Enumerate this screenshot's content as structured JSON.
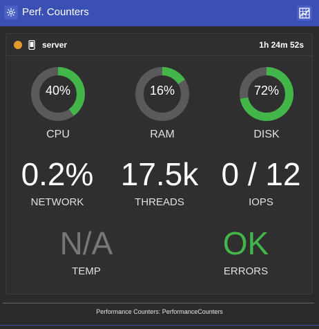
{
  "window": {
    "title": "Perf. Counters",
    "left_icon": "gear-icon",
    "right_icon": "chart-grid-icon",
    "accent_color": "#3a50b4"
  },
  "header": {
    "status_color": "#e39a2a",
    "device_icon": "phone-icon",
    "name": "server",
    "uptime": "1h 24m 52s"
  },
  "gauges": [
    {
      "label": "CPU",
      "value_text": "40%",
      "value": 40
    },
    {
      "label": "RAM",
      "value_text": "16%",
      "value": 16
    },
    {
      "label": "DISK",
      "value_text": "72%",
      "value": 72
    }
  ],
  "gauge_colors": {
    "fill": "#43b649",
    "track": "#5a5a5a"
  },
  "metrics_row1": [
    {
      "label": "NETWORK",
      "value": "0.2%"
    },
    {
      "label": "THREADS",
      "value": "17.5k"
    },
    {
      "label": "IOPS",
      "value": "0 / 12"
    }
  ],
  "metrics_row2": [
    {
      "label": "TEMP",
      "value": "N/A",
      "color": "#777777"
    },
    {
      "label": "ERRORS",
      "value": "OK",
      "color": "#43b649"
    }
  ],
  "footer": {
    "text": "Performance Counters: PerformanceCounters"
  }
}
